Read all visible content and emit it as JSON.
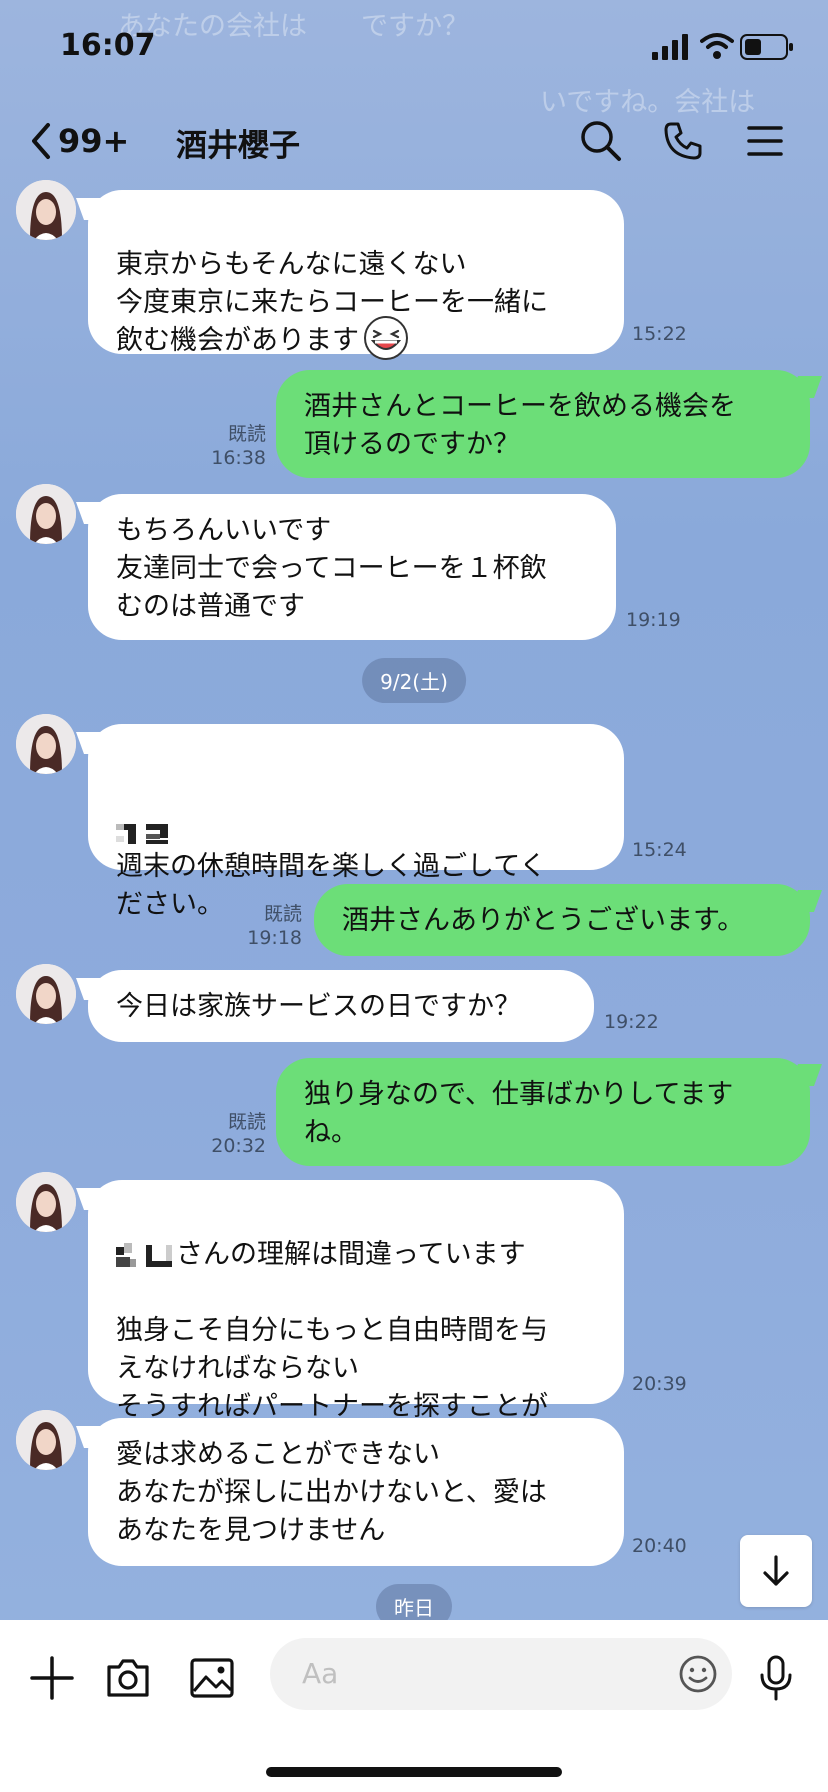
{
  "background_ghost": {
    "line1": "あなたの会社は",
    "line1_tail": "ですか？",
    "line2": "いですね。会社は"
  },
  "status_bar": {
    "time": "16:07"
  },
  "header": {
    "back_count": "99+",
    "title": "酒井櫻子"
  },
  "messages": [
    {
      "dir": "in",
      "text": "東京からもそんなに遠くない\n今度東京に来たらコーヒーを一緒に\n飲む機会があります",
      "emoji": "laughing-emoji",
      "time": "15:22"
    },
    {
      "dir": "out",
      "text": "酒井さんとコーヒーを飲める機会を\n頂けるのですか？",
      "read": "既読",
      "time": "16:38"
    },
    {
      "dir": "in",
      "text": "もちろんいいです\n友達同士で会ってコーヒーを１杯飲\nむのは普通です",
      "time": "19:19"
    },
    {
      "dir": "in",
      "text": "週末の休憩時間を楽しく過ごしてく\nださい。",
      "time": "15:24"
    },
    {
      "dir": "out",
      "text": "酒井さんありがとうございます。",
      "read": "既読",
      "time": "19:18"
    },
    {
      "dir": "in",
      "text": "今日は家族サービスの日ですか？",
      "time": "19:22"
    },
    {
      "dir": "out",
      "text": "独り身なので、仕事ばかりしてます\nね。",
      "read": "既読",
      "time": "20:32"
    },
    {
      "dir": "in",
      "text_first": "さんの理解は間違っています",
      "text": "独身こそ自分にもっと自由時間を与\nえなければならない\nそうすればパートナーを探すことが\nできる",
      "time": "20:39"
    },
    {
      "dir": "in",
      "text": "愛は求めることができない\nあなたが探しに出かけないと、愛は\nあなたを見つけません",
      "time": "20:40"
    }
  ],
  "date_separators": [
    "9/2(土)",
    "昨日"
  ],
  "input": {
    "placeholder": "Aa"
  },
  "icons": [
    "chevron-left-icon",
    "search-icon",
    "phone-icon",
    "menu-icon",
    "plus-icon",
    "camera-icon",
    "image-icon",
    "emoji-icon",
    "mic-icon",
    "arrow-down-icon"
  ]
}
